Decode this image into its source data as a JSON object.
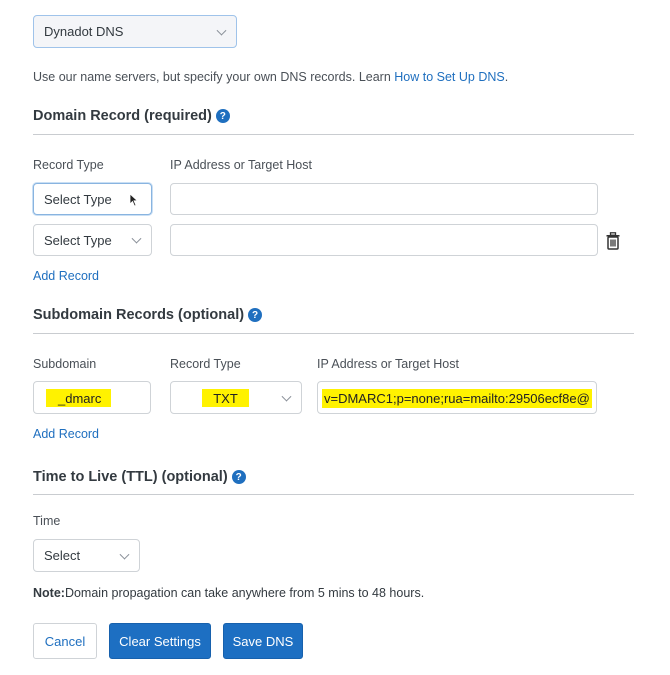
{
  "dns_type_select": {
    "value": "Dynadot DNS"
  },
  "intro": {
    "text": "Use our name servers, but specify your own DNS records. Learn ",
    "link": "How to Set Up DNS",
    "suffix": "."
  },
  "domain_record": {
    "heading": "Domain Record (required)",
    "col_record_type": "Record Type",
    "col_target": "IP Address or Target Host",
    "rows": [
      {
        "type": "Select Type",
        "target": ""
      },
      {
        "type": "Select Type",
        "target": ""
      }
    ],
    "add_label": "Add Record"
  },
  "subdomain_records": {
    "heading": "Subdomain Records (optional)",
    "col_subdomain": "Subdomain",
    "col_record_type": "Record Type",
    "col_target": "IP Address or Target Host",
    "row": {
      "subdomain": "_dmarc",
      "type": "TXT",
      "target": "v=DMARC1;p=none;rua=mailto:29506ecf8e@"
    },
    "add_label": "Add Record"
  },
  "ttl": {
    "heading": "Time to Live (TTL) (optional)",
    "time_label": "Time",
    "select_value": "Select"
  },
  "note": {
    "bold": "Note:",
    "text": "Domain propagation can take anywhere from 5 mins to 48 hours."
  },
  "buttons": {
    "cancel": "Cancel",
    "clear": "Clear Settings",
    "save": "Save DNS"
  },
  "help_glyph": "?",
  "colors": {
    "link": "#1f6fbf",
    "primary": "#1d6fc2",
    "highlight": "#fff200"
  }
}
